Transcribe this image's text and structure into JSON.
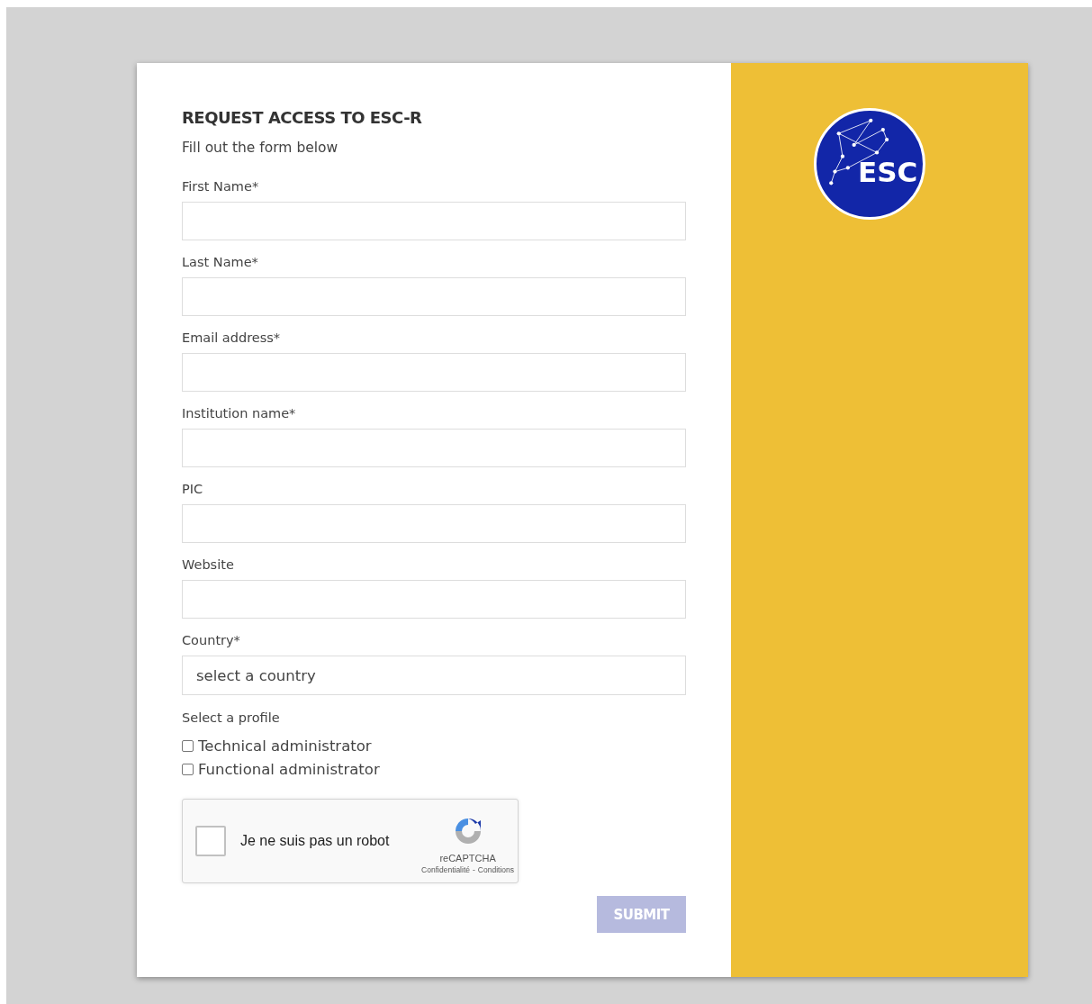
{
  "form": {
    "title": "REQUEST ACCESS TO ESC-R",
    "subtitle": "Fill out the form below",
    "fields": [
      {
        "label": "First Name*",
        "kind": "text"
      },
      {
        "label": "Last Name*",
        "kind": "text"
      },
      {
        "label": "Email address*",
        "kind": "text"
      },
      {
        "label": "Institution name*",
        "kind": "text"
      },
      {
        "label": "PIC",
        "kind": "text"
      },
      {
        "label": "Website",
        "kind": "text"
      },
      {
        "label": "Country*",
        "kind": "select",
        "placeholder": "select a country"
      }
    ],
    "profile": {
      "label": "Select a profile",
      "options": [
        {
          "label": "Technical administrator",
          "checked": false
        },
        {
          "label": "Functional administrator",
          "checked": false
        }
      ]
    },
    "captcha": {
      "label": "Je ne suis pas un robot",
      "checked": false,
      "brand": "reCAPTCHA",
      "links": [
        "Confidentialité",
        "Conditions"
      ],
      "separator": "-"
    },
    "submit": {
      "label": "SUBMIT",
      "disabled": true
    }
  },
  "logo": {
    "text": "ESC"
  }
}
